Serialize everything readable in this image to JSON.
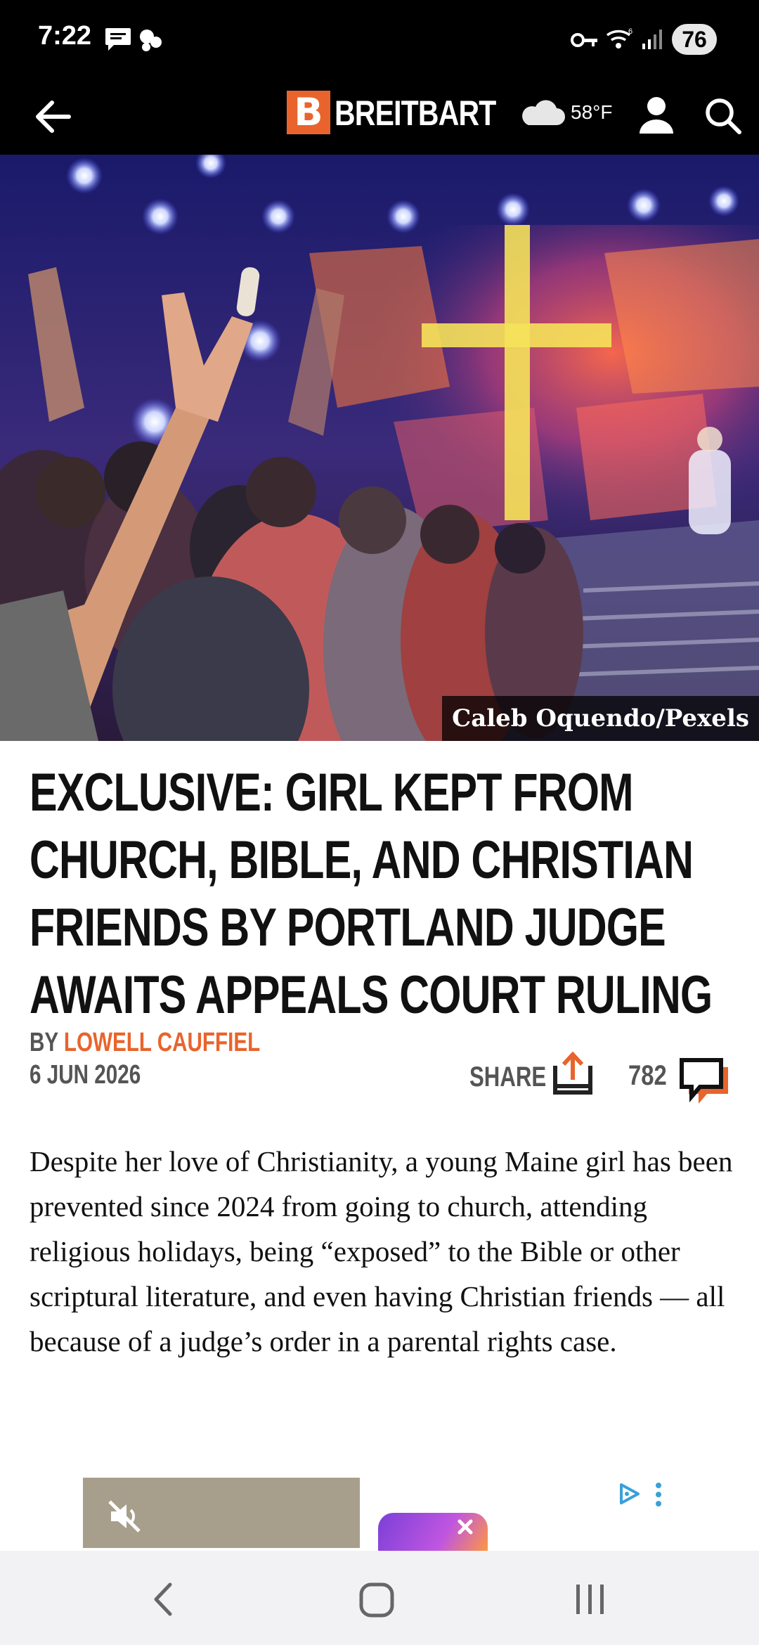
{
  "status_bar": {
    "time": "7:22",
    "battery": "76",
    "icons": [
      "message-icon",
      "notification-icon",
      "vpn-key-icon",
      "wifi-icon",
      "signal-icon"
    ]
  },
  "header": {
    "logo_letter": "B",
    "logo_text": "BREITBART",
    "temperature": "58°F",
    "icons": [
      "back-arrow-icon",
      "cloud-icon",
      "account-icon",
      "search-icon"
    ],
    "accent_color": "#e8642c"
  },
  "hero": {
    "photo_credit": "Caleb Oquendo/Pexels"
  },
  "article": {
    "headline": "EXCLUSIVE: GIRL KEPT FROM CHURCH, BIBLE, AND CHRISTIAN FRIENDS BY PORTLAND JUDGE AWAITS APPEALS COURT RULING",
    "byline_prefix": "BY ",
    "author": "LOWELL CAUFFIEL",
    "date": "6 JUN 2026",
    "share_label": "SHARE",
    "comment_count": "782",
    "body": "Despite her love of Christianity, a young Maine girl has been prevented since 2024 from going to church, attending religious holidays, being “exposed” to the Bible or other scriptural literature, and even having Christian friends — all because of a judge’s order in a parental rights case."
  },
  "ad": {
    "icons": [
      "mute-icon",
      "adchoices-icon",
      "more-options-icon"
    ]
  },
  "nav_bar": {
    "icons": [
      "nav-back-icon",
      "nav-home-icon",
      "nav-recents-icon"
    ]
  }
}
